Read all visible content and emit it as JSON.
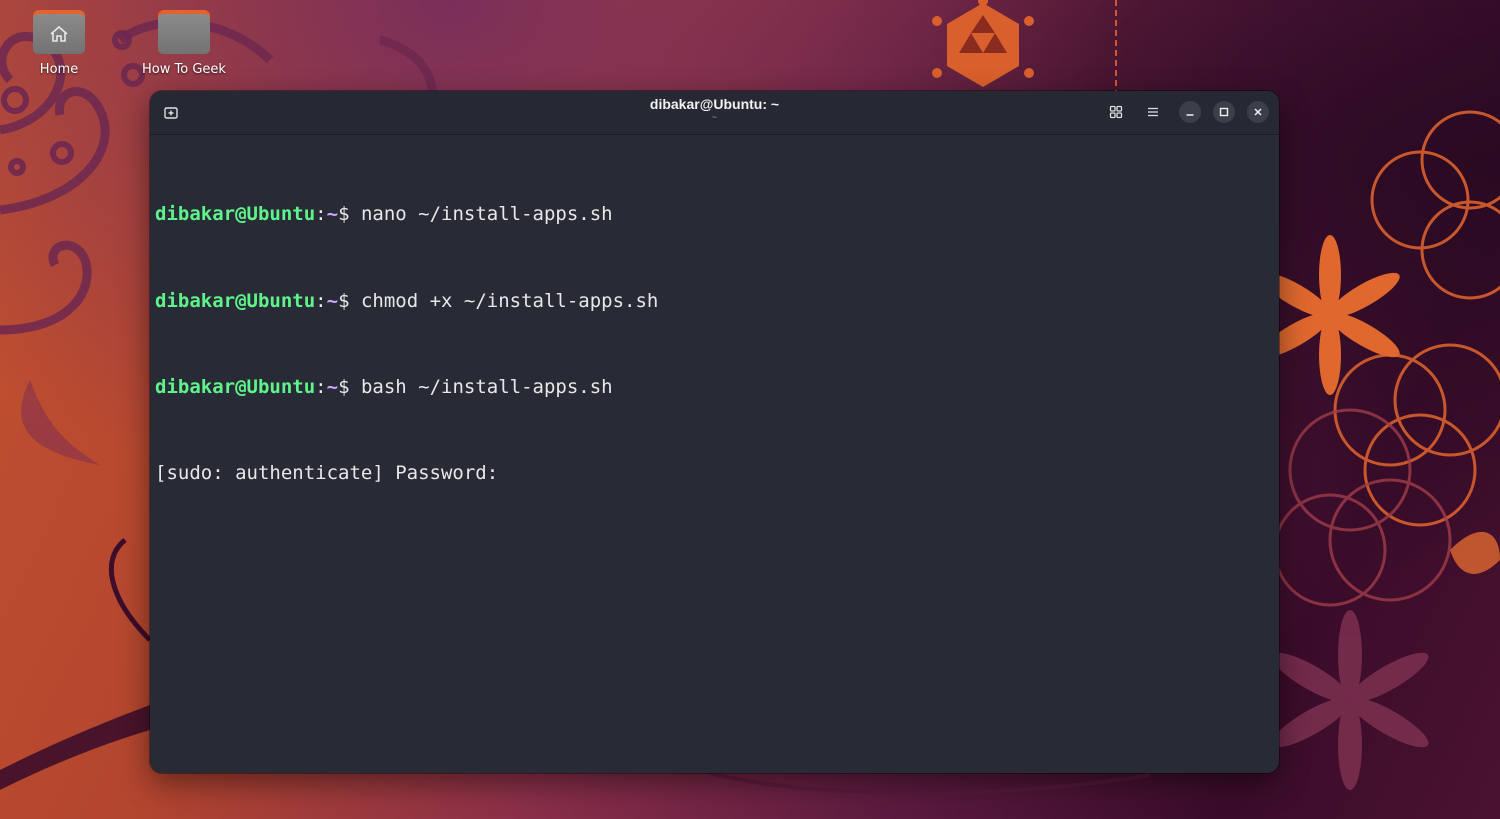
{
  "desktop": {
    "icons": [
      {
        "label": "Home",
        "icon": "home-folder-icon"
      },
      {
        "label": "How To Geek",
        "icon": "folder-icon"
      }
    ]
  },
  "window": {
    "title": "dibakar@Ubuntu: ~",
    "subtitle": "~",
    "buttons": {
      "new_tab": "new-tab-icon",
      "tab_overview": "tab-overview-icon",
      "menu": "hamburger-menu-icon",
      "minimize": "minimize-icon",
      "maximize": "maximize-icon",
      "close": "close-icon"
    }
  },
  "terminal": {
    "lines": [
      {
        "user": "dibakar@Ubuntu",
        "colon": ":",
        "path": "~",
        "symbol": "$ ",
        "command": "nano ~/install-apps.sh"
      },
      {
        "user": "dibakar@Ubuntu",
        "colon": ":",
        "path": "~",
        "symbol": "$ ",
        "command": "chmod +x ~/install-apps.sh"
      },
      {
        "user": "dibakar@Ubuntu",
        "colon": ":",
        "path": "~",
        "symbol": "$ ",
        "command": "bash ~/install-apps.sh"
      }
    ],
    "output": "[sudo: authenticate] Password:"
  },
  "colors": {
    "terminal_bg": "#282a36",
    "prompt_user": "#5ef48a",
    "prompt_path": "#c9a6ff",
    "accent": "#e4622c"
  }
}
